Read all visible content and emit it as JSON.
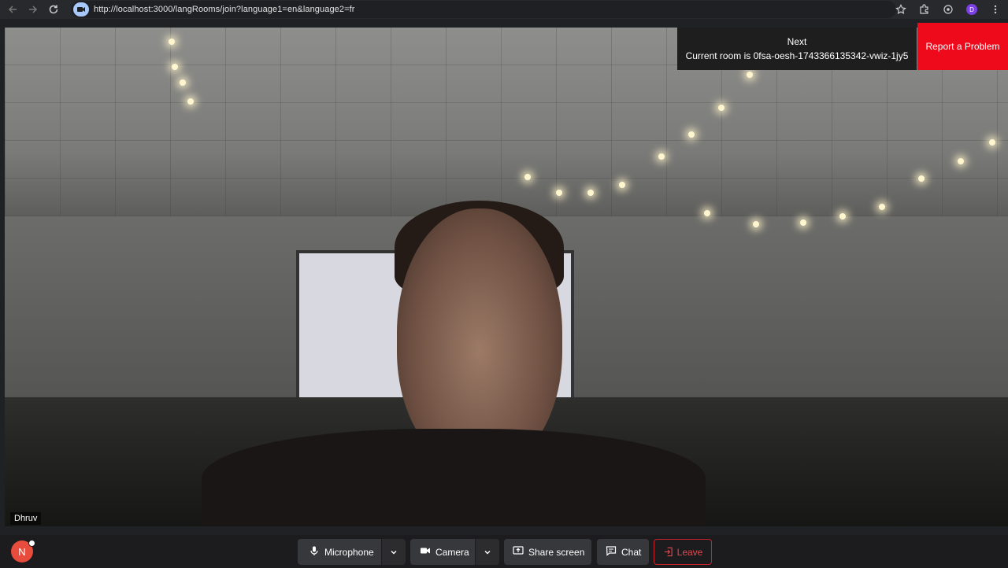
{
  "browser": {
    "url": "http://localhost:3000/langRooms/join?language1=en&language2=fr",
    "profile_initial": "D"
  },
  "room": {
    "next_label": "Next",
    "current_room_text": "Current room is 0fsa-oesh-1743366135342-vwiz-1jy5",
    "report_label": "Report a Problem"
  },
  "video": {
    "participant_name": "Dhruv"
  },
  "controls": {
    "avatar_initial": "N",
    "microphone_label": "Microphone",
    "camera_label": "Camera",
    "share_label": "Share screen",
    "chat_label": "Chat",
    "leave_label": "Leave"
  },
  "colors": {
    "report_bg": "#ee0a1a",
    "leave_border": "#c8232c",
    "avatar_bg": "#e74c3c"
  },
  "icons": [
    "back-icon",
    "forward-icon",
    "reload-icon",
    "site-icon",
    "star-icon",
    "extensions-icon",
    "cast-icon",
    "menu-icon",
    "microphone-icon",
    "chevron-down-icon",
    "camera-icon",
    "share-screen-icon",
    "chat-icon",
    "leave-icon"
  ]
}
